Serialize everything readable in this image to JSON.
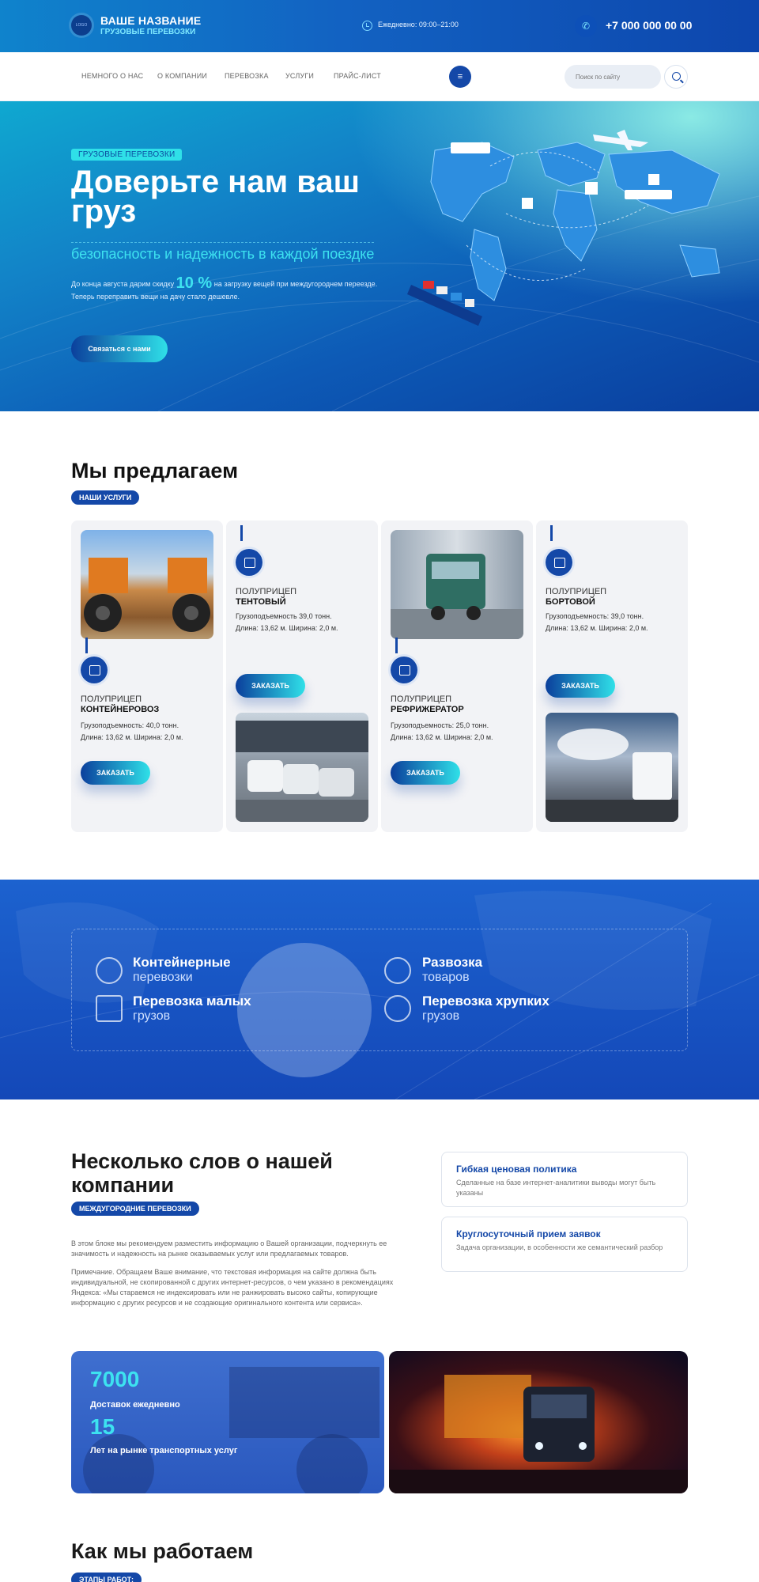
{
  "header": {
    "logo_text": "LOGO",
    "brand_name": "ВАШЕ НАЗВАНИЕ",
    "brand_tagline": "ГРУЗОВЫЕ ПЕРЕВОЗКИ",
    "hours": "Ежедневно: 09:00–21:00",
    "phone": "+7 000 000 00 00"
  },
  "nav": {
    "items": [
      "НЕМНОГО О НАС",
      "О КОМПАНИИ",
      "ПЕРЕВОЗКА",
      "УСЛУГИ",
      "ПРАЙС-ЛИСТ"
    ],
    "menu_icon": "≡",
    "search_placeholder": "Поиск по сайту"
  },
  "hero": {
    "tag": "ГРУЗОВЫЕ ПЕРЕВОЗКИ",
    "title": "Доверьте нам ваш груз",
    "subtitle": "безопасность и надежность в каждой поездке",
    "text_before": "До конца августа дарим скидку",
    "discount": "10 %",
    "text_after": "на загрузку вещей при междугороднем переезде. Теперь переправить вещи на дачу стало дешевле.",
    "button": "Связаться с нами"
  },
  "offer": {
    "title": "Мы предлагаем",
    "pill": "НАШИ УСЛУГИ",
    "cards": [
      {
        "type": "ПОЛУПРИЦЕП",
        "name": "КОНТЕЙНЕРОВОЗ",
        "desc": "Грузоподъемность: 40,0 тонн. Длина: 13,62 м. Ширина: 2,0 м.",
        "button": "ЗАКАЗАТЬ"
      },
      {
        "type": "ПОЛУПРИЦЕП",
        "name": "ТЕНТОВЫЙ",
        "desc": "Грузоподъемность  39,0 тонн. Длина: 13,62 м. Ширина: 2,0 м.",
        "button": "ЗАКАЗАТЬ"
      },
      {
        "type": "ПОЛУПРИЦЕП",
        "name": "РЕФРИЖЕРАТОР",
        "desc": "Грузоподъемность: 25,0 тонн. Длина: 13,62 м. Ширина: 2,0 м.",
        "button": "ЗАКАЗАТЬ"
      },
      {
        "type": "ПОЛУПРИЦЕП",
        "name": "БОРТОВОЙ",
        "desc": "Грузоподъемность: 39,0 тонн. Длина: 13,62 м. Ширина: 2,0 м.",
        "button": "ЗАКАЗАТЬ"
      }
    ]
  },
  "features": [
    {
      "title": "Контейнерные",
      "sub": "перевозки",
      "icon": "container-icon"
    },
    {
      "title": "Развозка",
      "sub": "товаров",
      "icon": "truck-icon"
    },
    {
      "title": "Перевозка малых",
      "sub": "грузов",
      "icon": "boxes-icon"
    },
    {
      "title": "Перевозка хрупких",
      "sub": "грузов",
      "icon": "globe-hand-icon"
    }
  ],
  "about": {
    "title": "Несколько слов о нашей компании",
    "pill": "МЕЖДУГОРОДНИЕ ПЕРЕВОЗКИ",
    "p1": "В этом блоке мы рекомендуем разместить информацию о Вашей организации, подчеркнуть ее значимость и надежность на рынке оказываемых услуг или предлагаемых товаров.",
    "p2": "Примечание. Обращаем Ваше внимание, что текстовая информация на сайте должна быть индивидуальной, не скопированной с других интернет-ресурсов, о чем указано в рекомендациях Яндекса: «Мы стараемся не индексировать или не ранжировать высоко сайты, копирующие информацию с других ресурсов и не создающие оригинального контента или сервиса».",
    "info": [
      {
        "title": "Гибкая ценовая политика",
        "text": "Сделанные на базе интернет-аналитики выводы могут быть указаны"
      },
      {
        "title": "Круглосуточный прием заявок",
        "text": "Задача организации, в особенности же семантический разбор"
      }
    ]
  },
  "stats": [
    {
      "value": "7000",
      "label": "Доставок ежедневно"
    },
    {
      "value": "15",
      "label": "Лет на рынке транспортных услуг"
    }
  ],
  "how": {
    "title": "Как мы работаем",
    "pill": "ЭТАПЫ РАБОТ:"
  },
  "colors": {
    "primary": "#1448a8",
    "accent": "#2fe0e8"
  }
}
